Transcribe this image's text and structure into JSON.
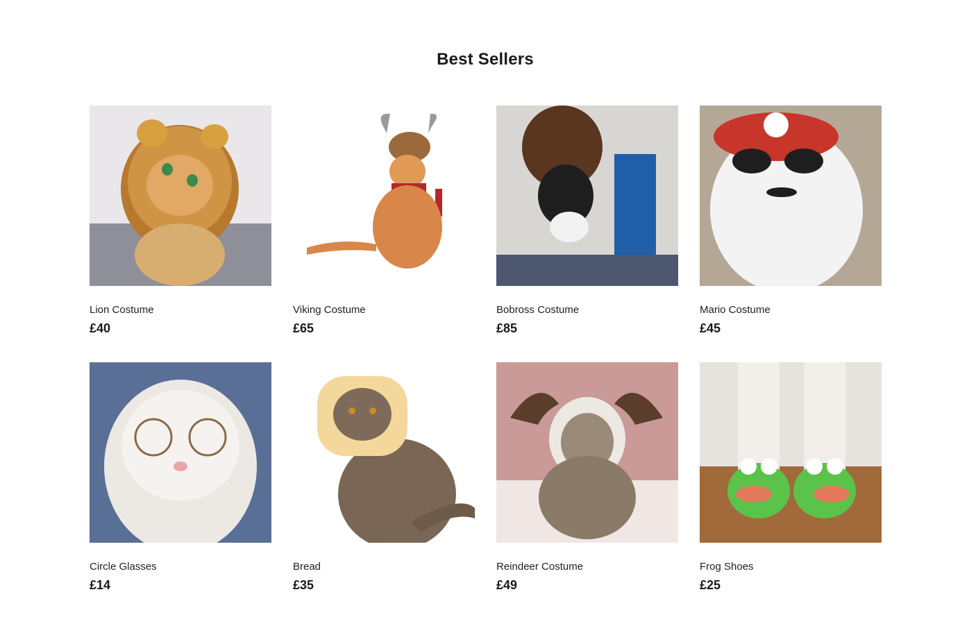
{
  "section": {
    "title": "Best Sellers"
  },
  "products": [
    {
      "name": "Lion Costume",
      "price": "£40",
      "image": "cat-lion-mane-photo"
    },
    {
      "name": "Viking Costume",
      "price": "£65",
      "image": "cat-viking-helmet-photo"
    },
    {
      "name": "Bobross Costume",
      "price": "£85",
      "image": "cat-bobross-wig-photo"
    },
    {
      "name": "Mario Costume",
      "price": "£45",
      "image": "cat-mario-cap-photo"
    },
    {
      "name": "Circle Glasses",
      "price": "£14",
      "image": "cat-round-glasses-photo"
    },
    {
      "name": "Bread",
      "price": "£35",
      "image": "cat-bread-slice-photo"
    },
    {
      "name": "Reindeer Costume",
      "price": "£49",
      "image": "cat-reindeer-hoodie-photo"
    },
    {
      "name": "Frog Shoes",
      "price": "£25",
      "image": "cat-frog-shoes-photo"
    }
  ]
}
